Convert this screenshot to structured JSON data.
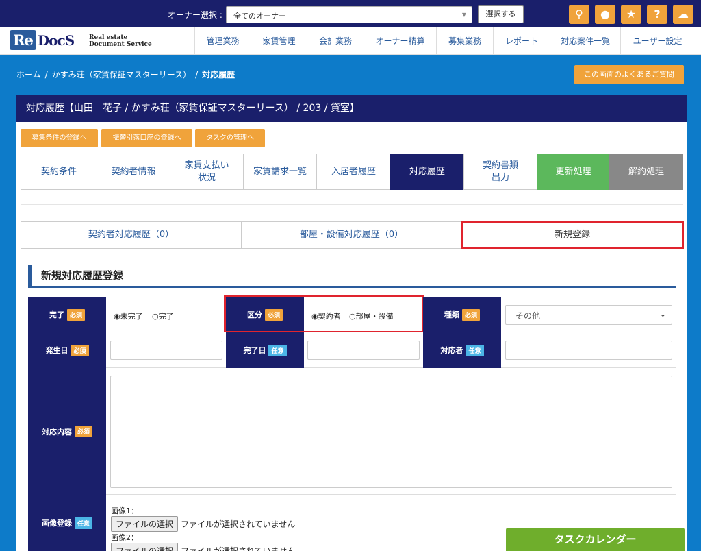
{
  "topbar": {
    "owner_label": "オーナー選択 :",
    "owner_select_value": "全てのオーナー",
    "select_button": "選択する",
    "icons": [
      "search-icon",
      "chat-icon",
      "star-icon",
      "help-icon",
      "cloud-icon"
    ]
  },
  "logo": {
    "re": "Re",
    "docs": "DocS",
    "sub1": "Real estate",
    "sub2": "Document Service"
  },
  "nav": [
    "管理業務",
    "家賃管理",
    "会計業務",
    "オーナー精算",
    "募集業務",
    "レポート",
    "対応案件一覧",
    "ユーザー設定"
  ],
  "breadcrumb": {
    "home": "ホーム",
    "property": "かすみ荘（家賃保証マスターリース）",
    "current": "対応履歴",
    "sep": "/"
  },
  "faq_button": "この画面のよくあるご質問",
  "card_title": "対応履歴【山田　花子 / かすみ荘（家賃保証マスターリース） / 203 / 貸室】",
  "action_buttons": [
    "募集条件の登録へ",
    "振替引落口座の登録へ",
    "タスクの管理へ"
  ],
  "tabs": [
    {
      "label": "契約条件"
    },
    {
      "label": "契約者情報"
    },
    {
      "label": "家賃支払い状況"
    },
    {
      "label": "家賃請求一覧"
    },
    {
      "label": "入居者履歴"
    },
    {
      "label": "対応履歴"
    },
    {
      "label": "契約書類出力"
    },
    {
      "label": "更新処理"
    },
    {
      "label": "解約処理"
    }
  ],
  "subtabs": [
    "契約者対応履歴（0）",
    "部屋・設備対応履歴（0）",
    "新規登録"
  ],
  "section_title": "新規対応履歴登録",
  "form": {
    "complete_label": "完了",
    "complete_options": [
      "◉未完了",
      "○完了"
    ],
    "category_label": "区分",
    "category_options": [
      "◉契約者",
      "○部屋・設備"
    ],
    "type_label": "種類",
    "type_value": "その他",
    "occurred_label": "発生日",
    "completed_date_label": "完了日",
    "handler_label": "対応者",
    "content_label": "対応内容",
    "image_label": "画像登録",
    "required_badge": "必須",
    "optional_badge": "任意",
    "image1_label": "画像1：",
    "image2_label": "画像2：",
    "file_button": "ファイルの選択",
    "no_file": "ファイルが選択されていません"
  },
  "task_calendar": "タスクカレンダー",
  "colors": {
    "navy": "#1a1f6b",
    "blue": "#0d7bc9",
    "orange": "#f0a33b",
    "green": "#5cb85c",
    "highlight": "#e0242e"
  }
}
